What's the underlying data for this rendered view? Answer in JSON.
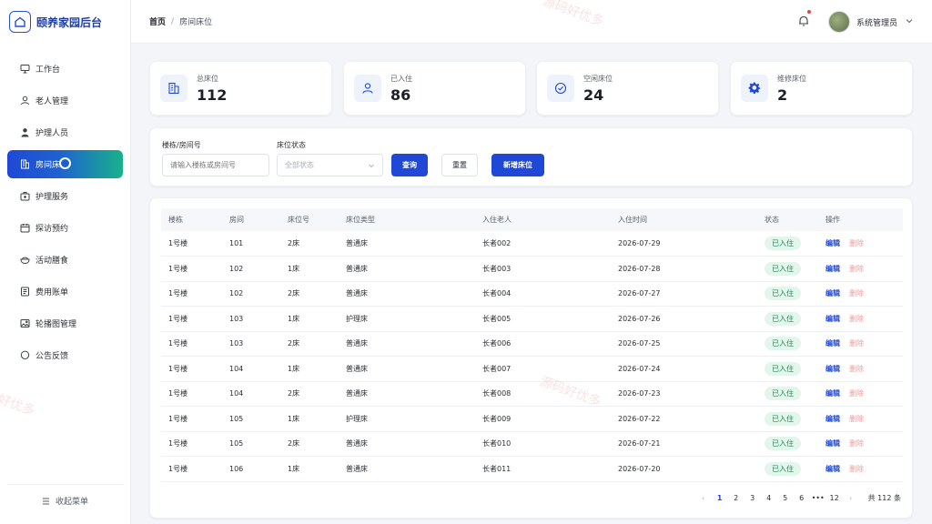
{
  "app": {
    "title": "颐养家园后台"
  },
  "sidebar": {
    "items": [
      {
        "label": "工作台",
        "icon": "monitor-icon"
      },
      {
        "label": "老人管理",
        "icon": "user-icon"
      },
      {
        "label": "护理人员",
        "icon": "person-icon"
      },
      {
        "label": "房间床位",
        "icon": "building-icon",
        "active": true
      },
      {
        "label": "护理服务",
        "icon": "medkit-icon"
      },
      {
        "label": "探访预约",
        "icon": "calendar-icon"
      },
      {
        "label": "活动膳食",
        "icon": "bowl-icon"
      },
      {
        "label": "费用账单",
        "icon": "bill-icon"
      },
      {
        "label": "轮播图管理",
        "icon": "image-icon"
      },
      {
        "label": "公告反馈",
        "icon": "chat-icon"
      }
    ],
    "collapse_label": "收起菜单"
  },
  "header": {
    "breadcrumb": {
      "home": "首页",
      "separator": "/",
      "current": "房间床位"
    },
    "user_name": "系统管理员"
  },
  "stats": [
    {
      "label": "总床位",
      "value": "112",
      "icon": "building-icon"
    },
    {
      "label": "已入住",
      "value": "86",
      "icon": "user-icon"
    },
    {
      "label": "空闲床位",
      "value": "24",
      "icon": "check-circle-icon"
    },
    {
      "label": "维修床位",
      "value": "2",
      "icon": "gear-icon"
    }
  ],
  "filter": {
    "room_label": "楼栋/房间号",
    "room_placeholder": "请输入楼栋或房间号",
    "status_label": "床位状态",
    "status_value": "全部状态",
    "search_button": "查询",
    "reset_button": "重置",
    "add_button": "新增床位"
  },
  "table": {
    "columns": [
      "楼栋",
      "房间",
      "床位号",
      "床位类型",
      "入住老人",
      "入住时间",
      "状态",
      "操作"
    ],
    "rows": [
      [
        "1号楼",
        "101",
        "2床",
        "普通床",
        "长者002",
        "2026-07-29",
        "已入住"
      ],
      [
        "1号楼",
        "102",
        "1床",
        "普通床",
        "长者003",
        "2026-07-28",
        "已入住"
      ],
      [
        "1号楼",
        "102",
        "2床",
        "普通床",
        "长者004",
        "2026-07-27",
        "已入住"
      ],
      [
        "1号楼",
        "103",
        "1床",
        "护理床",
        "长者005",
        "2026-07-26",
        "已入住"
      ],
      [
        "1号楼",
        "103",
        "2床",
        "普通床",
        "长者006",
        "2026-07-25",
        "已入住"
      ],
      [
        "1号楼",
        "104",
        "1床",
        "普通床",
        "长者007",
        "2026-07-24",
        "已入住"
      ],
      [
        "1号楼",
        "104",
        "2床",
        "普通床",
        "长者008",
        "2026-07-23",
        "已入住"
      ],
      [
        "1号楼",
        "105",
        "1床",
        "护理床",
        "长者009",
        "2026-07-22",
        "已入住"
      ],
      [
        "1号楼",
        "105",
        "2床",
        "普通床",
        "长者010",
        "2026-07-21",
        "已入住"
      ],
      [
        "1号楼",
        "106",
        "1床",
        "普通床",
        "长者011",
        "2026-07-20",
        "已入住"
      ]
    ],
    "edit_label": "编辑",
    "delete_label": "删除"
  },
  "pagination": {
    "prev": "‹",
    "pages": [
      "1",
      "2",
      "3",
      "4",
      "5",
      "6",
      "•••",
      "12"
    ],
    "current": "1",
    "next": "›",
    "total_text": "共 112 条"
  },
  "watermark": "源码好优多",
  "colors": {
    "primary": "#1f48d6",
    "accent_green": "#18b28a",
    "success_bg": "#e3f6ec",
    "danger_text": "#f09a9a"
  }
}
